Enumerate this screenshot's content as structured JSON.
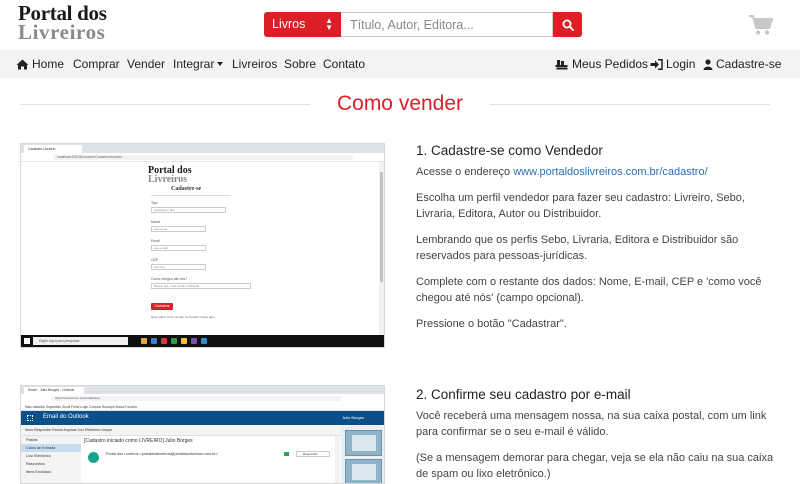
{
  "header": {
    "logo_line1": "Portal dos",
    "logo_line2": "Livreiros",
    "search_category": "Livros",
    "search_placeholder": "Título, Autor, Editora..."
  },
  "nav": {
    "left": [
      {
        "label": "Home",
        "icon": "home-icon"
      },
      {
        "label": "Comprar"
      },
      {
        "label": "Vender"
      },
      {
        "label": "Integrar",
        "dropdown": true
      },
      {
        "label": "Livreiros"
      },
      {
        "label": "Sobre"
      },
      {
        "label": "Contato"
      }
    ],
    "right": [
      {
        "label": "Meus Pedidos",
        "icon": "books-icon"
      },
      {
        "label": "Login",
        "icon": "sign-in-icon"
      },
      {
        "label": "Cadastre-se",
        "icon": "user-icon"
      }
    ]
  },
  "page_title": "Como vender",
  "steps": [
    {
      "title": "1. Cadastre-se como Vendedor",
      "p1_prefix": "Acesse o endereço ",
      "p1_link": "www.portaldoslivreiros.com.br/cadastro/",
      "p2": "Escolha um perfil vendedor para fazer seu cadastro: Livreiro, Sebo, Livraria, Editora, Autor ou Distribuidor.",
      "p3": "Lembrando que os perfis Sebo, Livraria, Editora e Distribuidor são reservados para pessoas-jurídicas.",
      "p4": "Complete com o restante dos dados: Nome, E-mail, CEP e 'como você chegou até nós' (campo opcional).",
      "p5": "Pressione o botão \"Cadastrar\"."
    },
    {
      "title": "2. Confirme seu cadastro por e-mail",
      "p1": "Você receberá uma mensagem nossa, na sua caixa postal, com um link para confirmar se o seu e-mail é válido.",
      "p2": "(Se a mensagem demorar para chegar, veja se ela não caiu na sua caixa de spam ou lixo eletrônico.)"
    }
  ],
  "shot1": {
    "tab": "Cadastro-Usuario",
    "url": "localhost:53104/Usuario/CadastroUsuario",
    "logo_line1": "Portal dos",
    "logo_line2": "Livreiros",
    "form_title": "Cadastre-se",
    "fields": [
      {
        "label": "Tipo",
        "value": "selecione o tipo"
      },
      {
        "label": "Nome",
        "value": "seu nome"
      },
      {
        "label": "Email",
        "value": "seu e-mail"
      },
      {
        "label": "CEP",
        "value": "seu cep"
      },
      {
        "label": "Como chegou até nós?",
        "value": "Busca, site, rede social, indicação"
      }
    ],
    "button": "Cadastrar",
    "small": "Quer saber como vender no Portal? Clique aqui",
    "taskbar_search": "Digite aqui para pesquisar"
  },
  "shot2": {
    "tab": "Email - Julio Borges - Outlook",
    "url": "https://outlook.live.com/mail/inbox",
    "bookmarks": "Mais visitados   Sugestões   Gmail   Portal   Login   Comprar   Buscapé   Busca Favorita",
    "app_title": "Email do Outlook",
    "user": "Julio Borges",
    "toolbar": "Novo   Responder   Excluir   Arquivar   Lixo Eletrônico   Limpar",
    "side": [
      "Pastas",
      "Caixa de Entrada",
      "Lixo Eletrônico",
      "Rascunhos",
      "Itens Enviados"
    ],
    "subject": "[Cadastro iniciado como LIVREIRO] Julio Borges",
    "from": "Portal dos Livreiros <portaldoslivreiros@portaldoslivreiros.com.br>",
    "reply": "Responder"
  },
  "colors": {
    "brand_red": "#dc1f26",
    "link_blue": "#2a6fb4",
    "outlook_blue": "#0b4f8a"
  }
}
